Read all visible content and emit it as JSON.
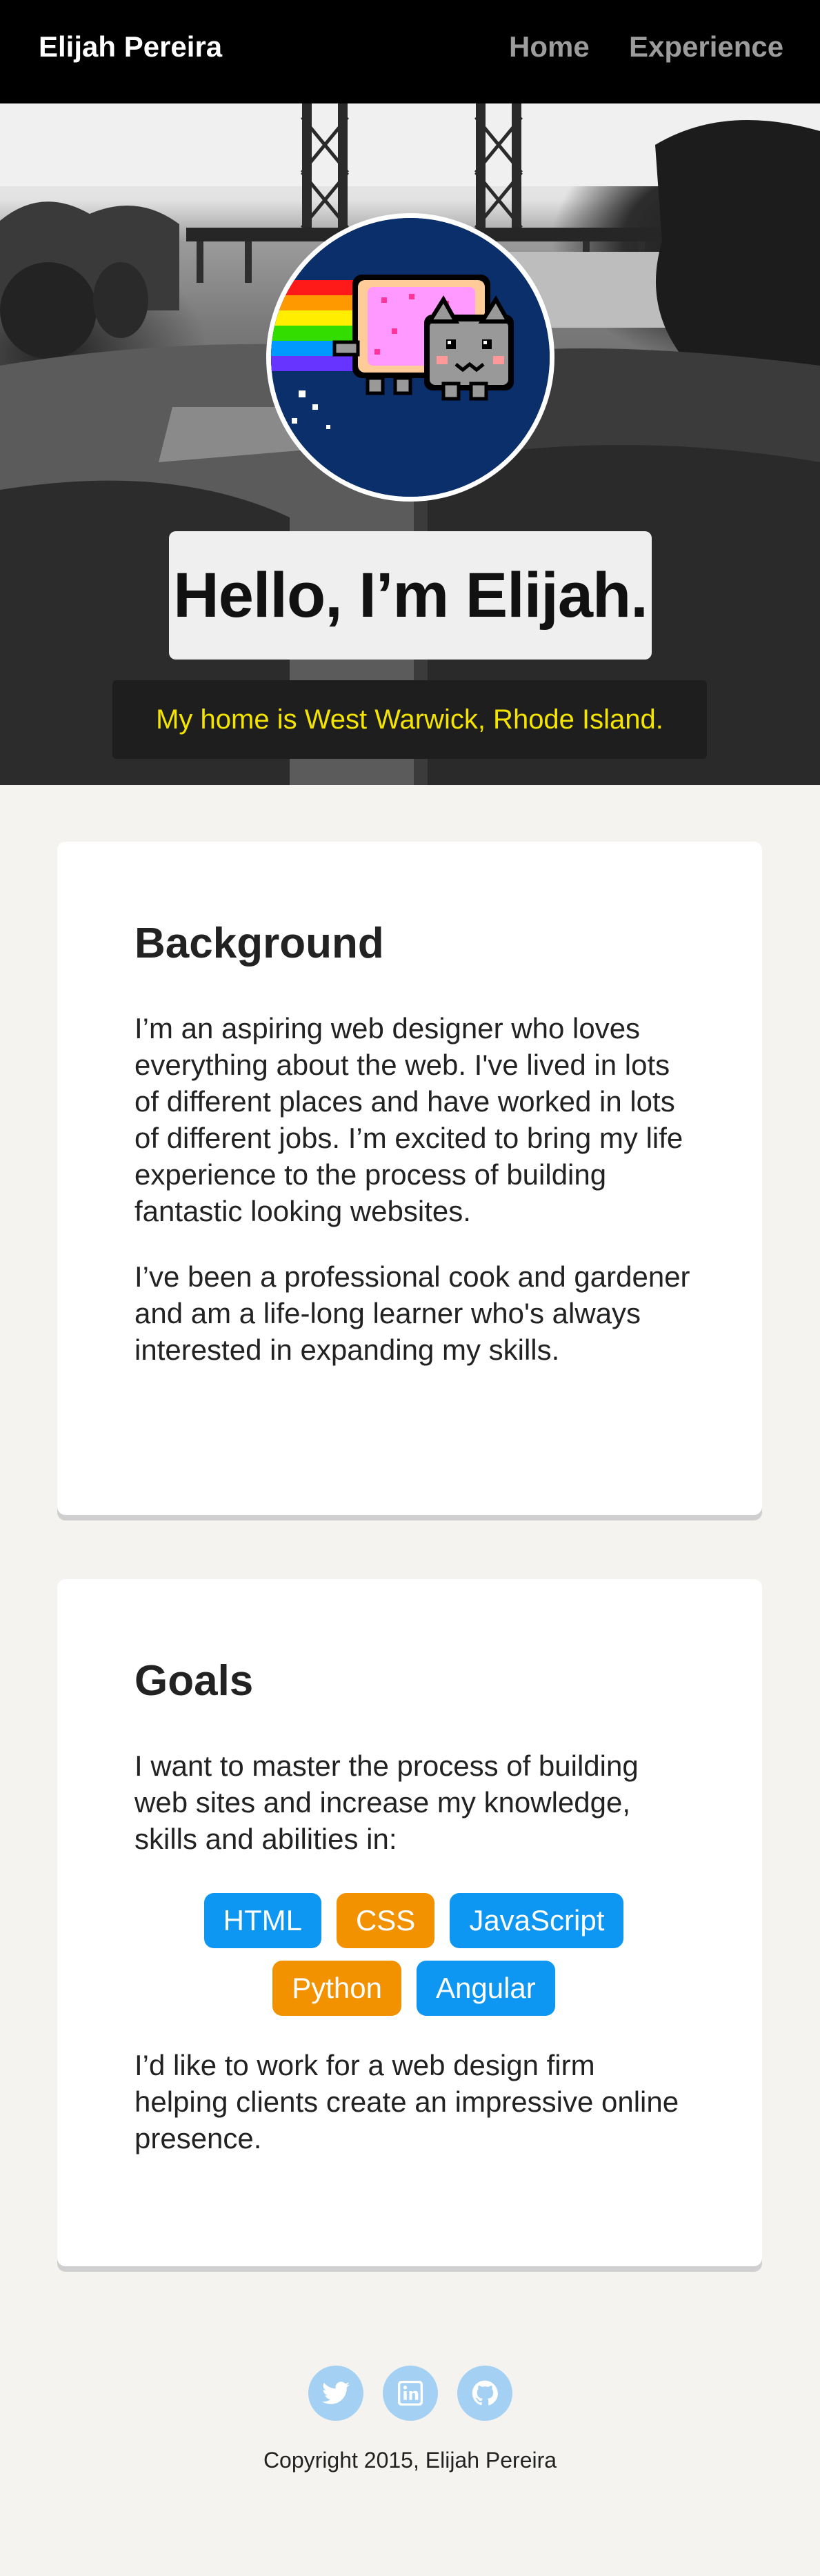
{
  "nav": {
    "brand": "Elijah Pereira",
    "links": [
      "Home",
      "Experience"
    ]
  },
  "hero": {
    "greeting": "Hello, I’m Elijah.",
    "location": "My home is West Warwick, Rhode Island."
  },
  "background": {
    "title": "Background",
    "paragraphs": [
      "I’m an aspiring web designer who loves everything about the web. I've lived in lots of different places and have worked in lots of different jobs. I’m excited to bring my life experience to the process of building fantastic looking websites.",
      "I’ve been a professional cook and gardener and am a life-long learner who's always interested in expanding my skills."
    ]
  },
  "goals": {
    "title": "Goals",
    "intro": "I want to master the process of building web sites and increase my knowledge, skills and abilities in:",
    "skills": [
      "HTML",
      "CSS",
      "JavaScript",
      "Python",
      "Angular"
    ],
    "outro": "I’d like to work for a web design firm helping clients create an impressive online presence."
  },
  "footer": {
    "socials": [
      "twitter-icon",
      "linkedin-icon",
      "github-icon"
    ],
    "copyright": "Copyright 2015, Elijah Pereira"
  },
  "colors": {
    "nav_bg": "#000000",
    "page_bg": "#f4f3ef",
    "location_text": "#f4e400",
    "tag_blue": "#0d96f2",
    "tag_orange": "#f29200",
    "social_bg": "#a4d1f3"
  }
}
